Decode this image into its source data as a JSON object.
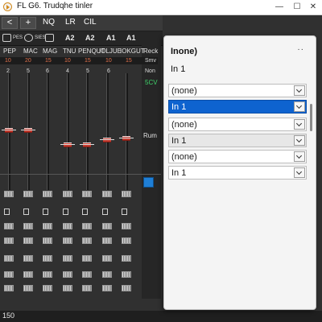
{
  "window": {
    "title": "FL G6. Trudqhe tinler",
    "minimize": "—",
    "maximize": "☐",
    "close": "✕"
  },
  "toolbar": {
    "back_label": "<",
    "add_label": "+",
    "nq_label": "NQ",
    "lr_label": "LR",
    "cil_label": "CIL"
  },
  "subtoolbar": {
    "pes_label": "PES",
    "sies_label": "SIES",
    "a_labels": [
      "A2",
      "A2",
      "A1",
      "A1"
    ]
  },
  "channels": {
    "headers": [
      "PEP",
      "MAC",
      "MAG",
      "TNU",
      "PENQUT",
      "IOLJUE",
      "IOKGUT",
      "Reck"
    ],
    "numbers": [
      "10",
      "20",
      "15",
      "10",
      "15",
      "10",
      "15",
      "Smv"
    ],
    "ch_numbers": [
      "2",
      "5",
      "6",
      "4",
      "5",
      "6",
      "Non"
    ],
    "side_label": "5CV",
    "run_label": "Rum"
  },
  "panel": {
    "title": "Inone)",
    "dots": "··",
    "subtitle": "In 1",
    "dropdowns": [
      {
        "value": "(none)",
        "state": "normal"
      },
      {
        "value": "In 1",
        "state": "selected"
      },
      {
        "value": "(none)",
        "state": "normal"
      },
      {
        "value": "In 1",
        "state": "gray"
      },
      {
        "value": "(none)",
        "state": "normal"
      },
      {
        "value": "In 1",
        "state": "normal"
      }
    ]
  },
  "status": {
    "text": "150"
  }
}
